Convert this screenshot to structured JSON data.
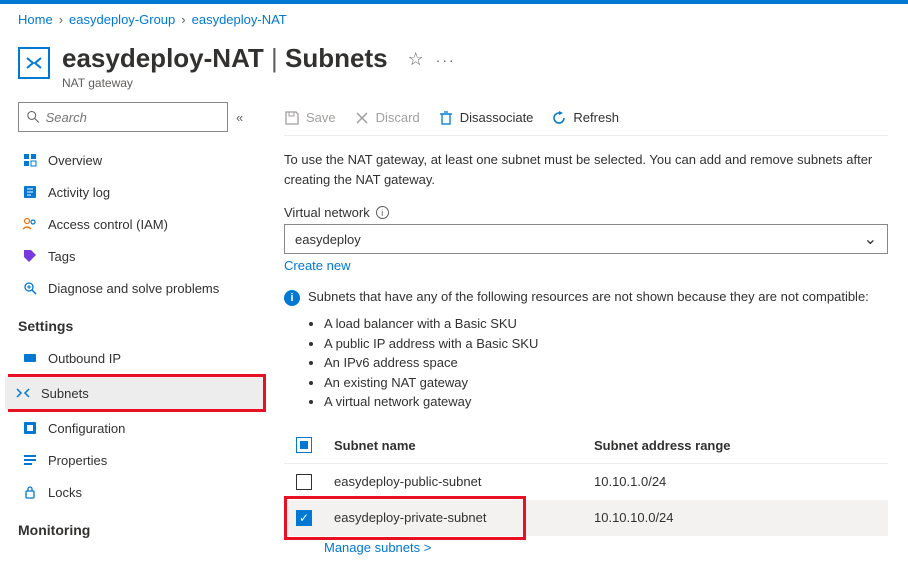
{
  "breadcrumb": [
    {
      "label": "Home"
    },
    {
      "label": "easydeploy-Group"
    },
    {
      "label": "easydeploy-NAT"
    }
  ],
  "header": {
    "title": "easydeploy-NAT",
    "section": "Subnets",
    "resource_type": "NAT gateway"
  },
  "search": {
    "placeholder": "Search"
  },
  "nav": {
    "top": [
      {
        "label": "Overview",
        "icon": "overview"
      },
      {
        "label": "Activity log",
        "icon": "log"
      },
      {
        "label": "Access control (IAM)",
        "icon": "iam"
      },
      {
        "label": "Tags",
        "icon": "tags"
      },
      {
        "label": "Diagnose and solve problems",
        "icon": "diag"
      }
    ],
    "settings_header": "Settings",
    "settings": [
      {
        "label": "Outbound IP",
        "icon": "ip"
      },
      {
        "label": "Subnets",
        "icon": "subnets",
        "active": true
      },
      {
        "label": "Configuration",
        "icon": "config"
      },
      {
        "label": "Properties",
        "icon": "props"
      },
      {
        "label": "Locks",
        "icon": "locks"
      }
    ],
    "monitoring_header": "Monitoring"
  },
  "toolbar": {
    "save": "Save",
    "discard": "Discard",
    "disassociate": "Disassociate",
    "refresh": "Refresh"
  },
  "main": {
    "intro": "To use the NAT gateway, at least one subnet must be selected. You can add and remove subnets after creating the NAT gateway.",
    "vnet_label": "Virtual network",
    "vnet_value": "easydeploy",
    "create_new": "Create new",
    "banner": "Subnets that have any of the following resources are not shown because they are not compatible:",
    "incompat": [
      "A load balancer with a Basic SKU",
      "A public IP address with a Basic SKU",
      "An IPv6 address space",
      "An existing NAT gateway",
      "A virtual network gateway"
    ],
    "col_name": "Subnet name",
    "col_range": "Subnet address range",
    "rows": [
      {
        "name": "easydeploy-public-subnet",
        "range": "10.10.1.0/24",
        "checked": false
      },
      {
        "name": "easydeploy-private-subnet",
        "range": "10.10.10.0/24",
        "checked": true
      }
    ],
    "manage": "Manage subnets >"
  }
}
